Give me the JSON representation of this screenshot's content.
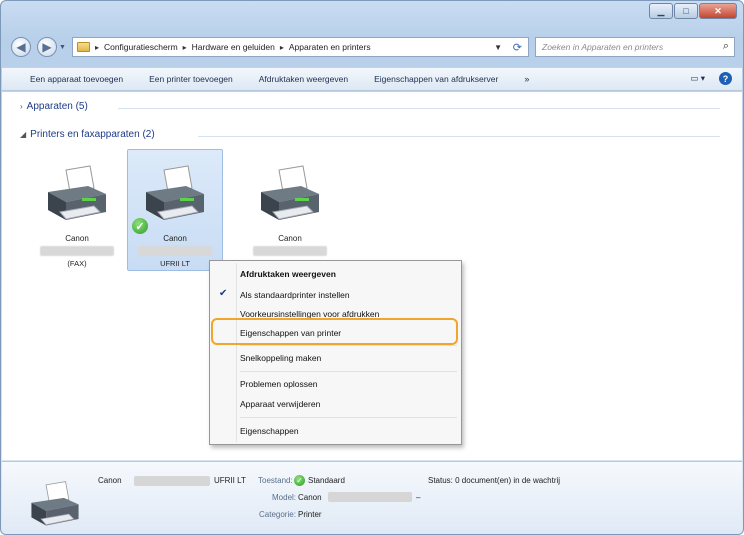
{
  "window": {
    "minimize_icon": "minimize-icon",
    "maximize_icon": "maximize-icon",
    "close_icon": "close-icon",
    "close_glyph": "✕"
  },
  "address": {
    "back_icon": "back-arrow-icon",
    "forward_icon": "forward-arrow-icon",
    "crumbs": [
      "Configuratiescherm",
      "Hardware en geluiden",
      "Apparaten en printers"
    ],
    "search_placeholder": "Zoeken in Apparaten en printers"
  },
  "toolbar": {
    "items": [
      "Een apparaat toevoegen",
      "Een printer toevoegen",
      "Afdruktaken weergeven",
      "Eigenschappen van afdrukserver"
    ],
    "more": "»"
  },
  "groups": {
    "devices": "Apparaten (5)",
    "printers": "Printers en faxapparaten (2)"
  },
  "printers": [
    {
      "name": "Canon",
      "sub": "(FAX)"
    },
    {
      "name": "Canon",
      "sub": "UFRII LT",
      "default": true
    },
    {
      "name": "Canon",
      "sub": ""
    }
  ],
  "context_menu": {
    "items": [
      "Afdruktaken weergeven",
      "Als standaardprinter instellen",
      "Voorkeursinstellingen voor afdrukken",
      "Eigenschappen van printer",
      "Snelkoppeling maken",
      "Problemen oplossen",
      "Apparaat verwijderen",
      "Eigenschappen"
    ],
    "highlight_color": "#f0a62a"
  },
  "statusbar": {
    "name": "Canon",
    "suffix": "UFRII LT",
    "state_label": "Toestand:",
    "state_value": "Standaard",
    "status": "Status: 0 document(en) in de wachtrij",
    "model_label": "Model:",
    "model_value": "Canon",
    "model_dash": "–",
    "category_label": "Categorie:",
    "category_value": "Printer"
  }
}
